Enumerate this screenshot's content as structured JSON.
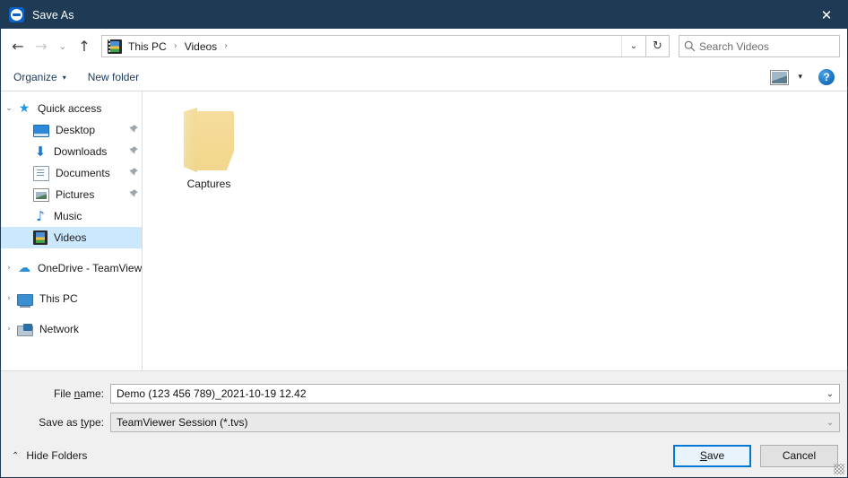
{
  "window": {
    "title": "Save As",
    "app_icon": "teamviewer-logo-icon",
    "close_label": "✕",
    "titlebar_color": "#1f3a54"
  },
  "navigation": {
    "back": "←",
    "forward": "→",
    "recent": "⌄",
    "up": "↑",
    "refresh": "↻",
    "address_dropdown": "⌄"
  },
  "address": {
    "icon": "videos-folder-icon",
    "crumbs": [
      "This PC",
      "Videos"
    ],
    "separator": "›"
  },
  "search": {
    "icon": "search-icon",
    "placeholder": "Search Videos"
  },
  "toolbar": {
    "organize": "Organize",
    "organize_caret": "▾",
    "new_folder": "New folder",
    "view_caret": "▾",
    "help": "?"
  },
  "sidebar": {
    "items": [
      {
        "label": "Quick access",
        "icon": "star-icon",
        "twisty": "⌄",
        "indent": 0,
        "pin": false,
        "selected": false
      },
      {
        "label": "Desktop",
        "icon": "desktop-icon",
        "twisty": "",
        "indent": 1,
        "pin": true,
        "selected": false
      },
      {
        "label": "Downloads",
        "icon": "download-icon",
        "twisty": "",
        "indent": 1,
        "pin": true,
        "selected": false
      },
      {
        "label": "Documents",
        "icon": "documents-icon",
        "twisty": "",
        "indent": 1,
        "pin": true,
        "selected": false
      },
      {
        "label": "Pictures",
        "icon": "pictures-icon",
        "twisty": "",
        "indent": 1,
        "pin": true,
        "selected": false
      },
      {
        "label": "Music",
        "icon": "music-icon",
        "twisty": "",
        "indent": 1,
        "pin": false,
        "selected": false
      },
      {
        "label": "Videos",
        "icon": "videos-icon",
        "twisty": "",
        "indent": 1,
        "pin": false,
        "selected": true
      },
      {
        "label": "OneDrive - TeamView",
        "icon": "cloud-icon",
        "twisty": "›",
        "indent": 0,
        "pin": false,
        "selected": false
      },
      {
        "label": "This PC",
        "icon": "this-pc-icon",
        "twisty": "›",
        "indent": 0,
        "pin": false,
        "selected": false
      },
      {
        "label": "Network",
        "icon": "network-icon",
        "twisty": "›",
        "indent": 0,
        "pin": false,
        "selected": false
      }
    ],
    "pin_glyph": "📌",
    "selected_color": "#cce8ff"
  },
  "files": [
    {
      "name": "Captures",
      "type": "folder"
    }
  ],
  "form": {
    "filename_label_pre": "File ",
    "filename_label_mnemonic": "n",
    "filename_label_post": "ame:",
    "filename_value": "Demo (123 456 789)_2021-10-19 12.42",
    "filetype_label_pre": "Save as ",
    "filetype_label_mnemonic": "t",
    "filetype_label_post": "ype:",
    "filetype_value": "TeamViewer Session (*.tvs)",
    "dropdown_arrow": "⌄"
  },
  "footer": {
    "hide_folders": "Hide Folders",
    "hide_folders_caret": "⌃",
    "save_pre": "",
    "save_mnemonic": "S",
    "save_post": "ave",
    "cancel_label": "Cancel",
    "accent_color": "#0078d7"
  }
}
